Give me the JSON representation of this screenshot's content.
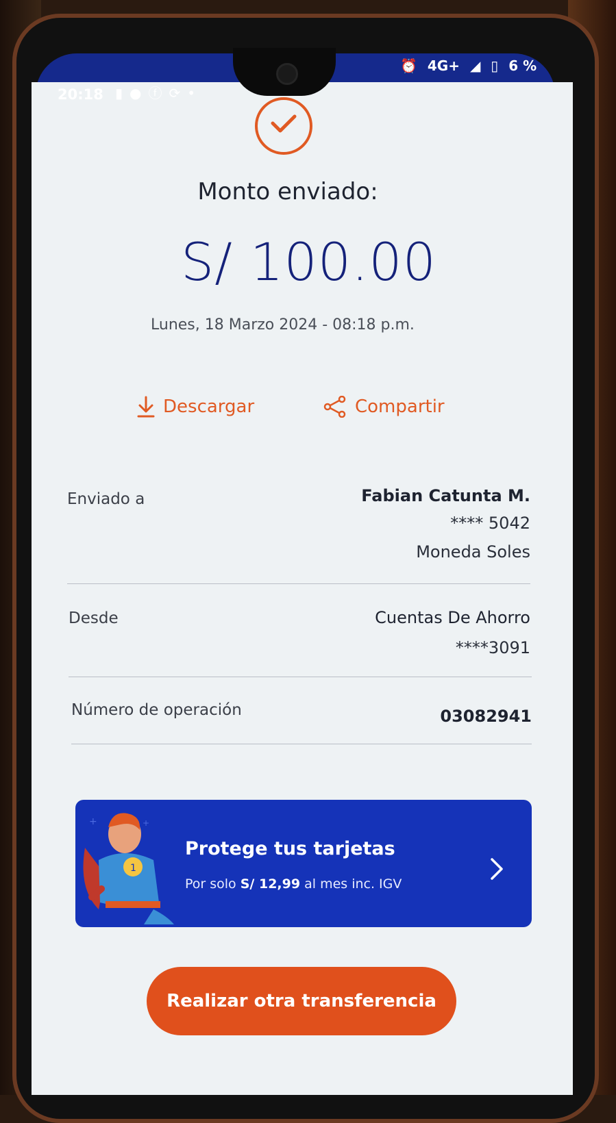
{
  "status_bar": {
    "time": "20:18",
    "network": "4G+",
    "battery": "6 %"
  },
  "receipt": {
    "title": "Monto enviado:",
    "amount": "S/ 100.00",
    "datetime": "Lunes, 18 Marzo 2024 - 08:18 p.m."
  },
  "actions": {
    "download_label": "Descargar",
    "share_label": "Compartir"
  },
  "details": {
    "sent_to_label": "Enviado a",
    "sent_to_name": "Fabian Catunta M.",
    "sent_to_account": "**** 5042",
    "sent_to_currency": "Moneda Soles",
    "from_label": "Desde",
    "from_account_type": "Cuentas De Ahorro",
    "from_account": "****3091",
    "operation_label": "Número de operación",
    "operation_number": "03082941"
  },
  "promo": {
    "title": "Protege tus tarjetas",
    "sub_prefix": "Por solo ",
    "sub_price": "S/ 12,99",
    "sub_suffix": " al mes inc. IGV"
  },
  "cta_label": "Realizar otra transferencia",
  "colors": {
    "brand_blue": "#15298c",
    "accent_orange": "#e05a23",
    "promo_blue": "#1533b8"
  }
}
